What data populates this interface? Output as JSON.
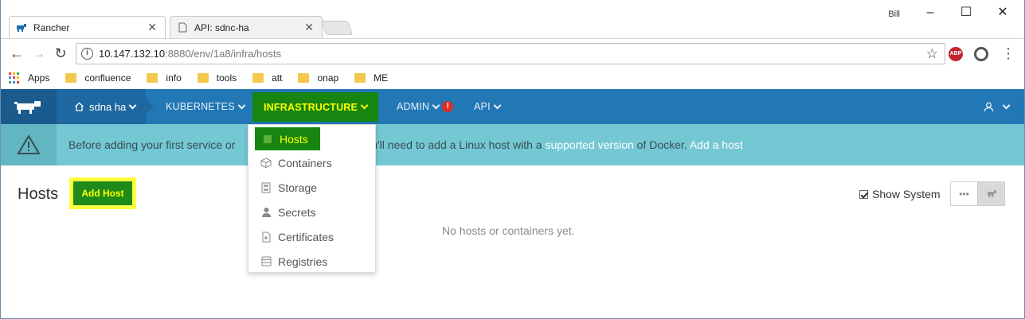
{
  "browser": {
    "tabs": [
      {
        "label": "Rancher",
        "icon": "rancher-icon",
        "active": true
      },
      {
        "label": "API: sdnc-ha",
        "icon": "page-icon",
        "active": false
      }
    ],
    "profile": "Bill",
    "address": {
      "host": "10.147.132.10",
      "rest": ":8880/env/1a8/infra/hosts"
    },
    "bookmarks": [
      "Apps",
      "confluence",
      "info",
      "tools",
      "att",
      "onap",
      "ME"
    ]
  },
  "header": {
    "environment": "sdna ha",
    "nav": [
      "KUBERNETES",
      "INFRASTRUCTURE",
      "ADMIN",
      "API"
    ],
    "admin_alert": "!"
  },
  "banner": {
    "text_before": "Before adding your first service or",
    "text_middle": "u'll need to add a Linux host with a",
    "link_supported": "supported version",
    "text_after": "of Docker.",
    "link_add": "Add a host"
  },
  "page": {
    "title": "Hosts",
    "add_button": "Add Host",
    "show_system": "Show System",
    "show_system_checked": true,
    "empty_message": "No hosts or containers yet."
  },
  "dropdown": {
    "items": [
      {
        "label": "Hosts",
        "icon": "hosts-icon"
      },
      {
        "label": "Containers",
        "icon": "containers-icon"
      },
      {
        "label": "Storage",
        "icon": "storage-icon"
      },
      {
        "label": "Secrets",
        "icon": "secrets-icon"
      },
      {
        "label": "Certificates",
        "icon": "certificates-icon"
      },
      {
        "label": "Registries",
        "icon": "registries-icon"
      }
    ]
  },
  "colors": {
    "header_blue": "#2277b5",
    "banner_teal": "#73c8d4",
    "highlight_green": "#17850f",
    "highlight_yellow": "#ffff00"
  }
}
